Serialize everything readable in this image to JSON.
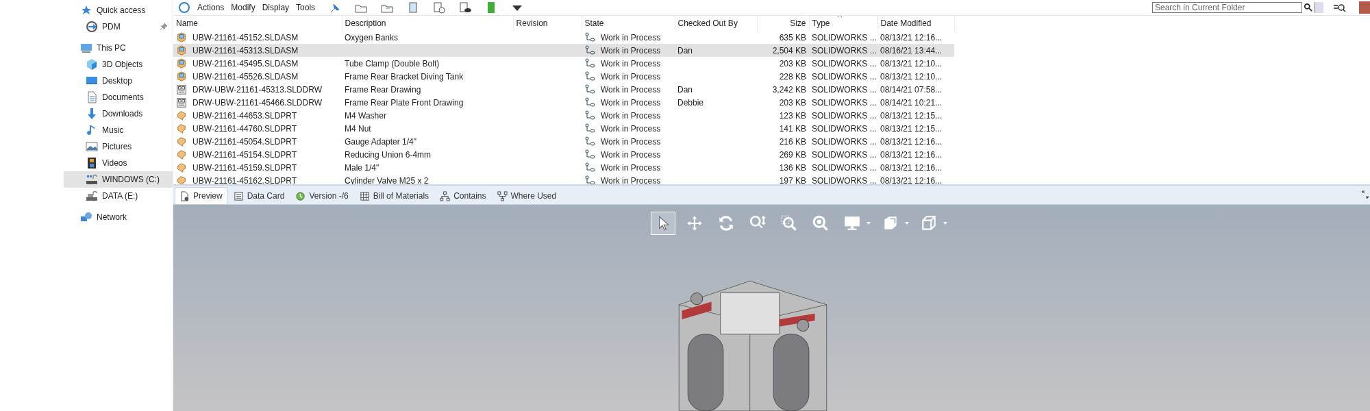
{
  "sidebar": {
    "items": [
      {
        "label": "Quick access",
        "kind": "group",
        "selected": false,
        "pinned": false
      },
      {
        "label": "PDM",
        "kind": "child",
        "selected": false,
        "pinned": true
      },
      {
        "label": "This PC",
        "kind": "group",
        "selected": false,
        "pinned": false
      },
      {
        "label": "3D Objects",
        "kind": "child",
        "selected": false,
        "pinned": false
      },
      {
        "label": "Desktop",
        "kind": "child",
        "selected": false,
        "pinned": false
      },
      {
        "label": "Documents",
        "kind": "child",
        "selected": false,
        "pinned": false
      },
      {
        "label": "Downloads",
        "kind": "child",
        "selected": false,
        "pinned": false
      },
      {
        "label": "Music",
        "kind": "child",
        "selected": false,
        "pinned": false
      },
      {
        "label": "Pictures",
        "kind": "child",
        "selected": false,
        "pinned": false
      },
      {
        "label": "Videos",
        "kind": "child",
        "selected": false,
        "pinned": false
      },
      {
        "label": "WINDOWS (C:)",
        "kind": "child",
        "selected": true,
        "pinned": false
      },
      {
        "label": "DATA (E:)",
        "kind": "child",
        "selected": false,
        "pinned": false
      },
      {
        "label": "Network",
        "kind": "group",
        "selected": false,
        "pinned": false
      }
    ]
  },
  "toolbar": {
    "menus": [
      "Actions",
      "Modify",
      "Display",
      "Tools"
    ],
    "search": {
      "placeholder": "Search in Current Folder"
    }
  },
  "table": {
    "columns": [
      {
        "label": "Name",
        "sorted": false
      },
      {
        "label": "Description",
        "sorted": false
      },
      {
        "label": "Revision",
        "sorted": false
      },
      {
        "label": "State",
        "sorted": false
      },
      {
        "label": "Checked Out By",
        "sorted": false
      },
      {
        "label": "Size",
        "sorted": false
      },
      {
        "label": "Type",
        "sorted": true
      },
      {
        "label": "Date Modified",
        "sorted": false
      }
    ],
    "rows": [
      {
        "kind": "assembly",
        "name": "UBW-21161-45152.SLDASM",
        "description": "Oxygen Banks",
        "state": "Work in Process",
        "checked_out_by": "",
        "size": "635 KB",
        "type": "SOLIDWORKS ...",
        "date": "08/13/21 12:16...",
        "selected": false
      },
      {
        "kind": "assembly",
        "name": "UBW-21161-45313.SLDASM",
        "description": "",
        "state": "Work in Process",
        "checked_out_by": "Dan",
        "size": "2,504 KB",
        "type": "SOLIDWORKS ...",
        "date": "08/16/21 13:44...",
        "selected": true
      },
      {
        "kind": "assembly",
        "name": "UBW-21161-45495.SLDASM",
        "description": "Tube Clamp (Double Bolt)",
        "state": "Work in Process",
        "checked_out_by": "",
        "size": "203 KB",
        "type": "SOLIDWORKS ...",
        "date": "08/13/21 12:10...",
        "selected": false
      },
      {
        "kind": "assembly",
        "name": "UBW-21161-45526.SLDASM",
        "description": "Frame Rear Bracket Diving Tank",
        "state": "Work in Process",
        "checked_out_by": "",
        "size": "228 KB",
        "type": "SOLIDWORKS ...",
        "date": "08/13/21 12:10...",
        "selected": false
      },
      {
        "kind": "drawing",
        "name": "DRW-UBW-21161-45313.SLDDRW",
        "description": "Frame Rear Drawing",
        "state": "Work in Process",
        "checked_out_by": "Dan",
        "size": "3,242 KB",
        "type": "SOLIDWORKS ...",
        "date": "08/14/21 07:58...",
        "selected": false
      },
      {
        "kind": "drawing",
        "name": "DRW-UBW-21161-45466.SLDDRW",
        "description": "Frame Rear Plate Front Drawing",
        "state": "Work in Process",
        "checked_out_by": "Debbie",
        "size": "203 KB",
        "type": "SOLIDWORKS ...",
        "date": "08/14/21 10:21...",
        "selected": false
      },
      {
        "kind": "part",
        "name": "UBW-21161-44653.SLDPRT",
        "description": "M4 Washer",
        "state": "Work in Process",
        "checked_out_by": "",
        "size": "123 KB",
        "type": "SOLIDWORKS ...",
        "date": "08/13/21 12:15...",
        "selected": false
      },
      {
        "kind": "part",
        "name": "UBW-21161-44760.SLDPRT",
        "description": "M4 Nut",
        "state": "Work in Process",
        "checked_out_by": "",
        "size": "141 KB",
        "type": "SOLIDWORKS ...",
        "date": "08/13/21 12:15...",
        "selected": false
      },
      {
        "kind": "part",
        "name": "UBW-21161-45054.SLDPRT",
        "description": "Gauge Adapter 1/4\"",
        "state": "Work in Process",
        "checked_out_by": "",
        "size": "216 KB",
        "type": "SOLIDWORKS ...",
        "date": "08/13/21 12:16...",
        "selected": false
      },
      {
        "kind": "part",
        "name": "UBW-21161-45154.SLDPRT",
        "description": "Reducing Union 6-4mm",
        "state": "Work in Process",
        "checked_out_by": "",
        "size": "269 KB",
        "type": "SOLIDWORKS ...",
        "date": "08/13/21 12:16...",
        "selected": false
      },
      {
        "kind": "part",
        "name": "UBW-21161-45159.SLDPRT",
        "description": "Male 1/4\"",
        "state": "Work in Process",
        "checked_out_by": "",
        "size": "136 KB",
        "type": "SOLIDWORKS ...",
        "date": "08/13/21 12:16...",
        "selected": false
      },
      {
        "kind": "part",
        "name": "UBW-21161-45162.SLDPRT",
        "description": "Cylinder Valve M25 x 2",
        "state": "Work in Process",
        "checked_out_by": "",
        "size": "197 KB",
        "type": "SOLIDWORKS ...",
        "date": "08/13/21 12:16...",
        "selected": false
      }
    ]
  },
  "tabs": [
    {
      "label": "Preview",
      "selected": true
    },
    {
      "label": "Data Card",
      "selected": false
    },
    {
      "label": "Version -/6",
      "selected": false
    },
    {
      "label": "Bill of Materials",
      "selected": false
    },
    {
      "label": "Contains",
      "selected": false
    },
    {
      "label": "Where Used",
      "selected": false
    }
  ],
  "view_tools": [
    {
      "selected": true
    },
    {
      "selected": false
    },
    {
      "selected": false
    },
    {
      "selected": false
    },
    {
      "selected": false
    },
    {
      "selected": false
    },
    {
      "selected": false
    },
    {
      "selected": false
    },
    {
      "selected": false
    }
  ]
}
